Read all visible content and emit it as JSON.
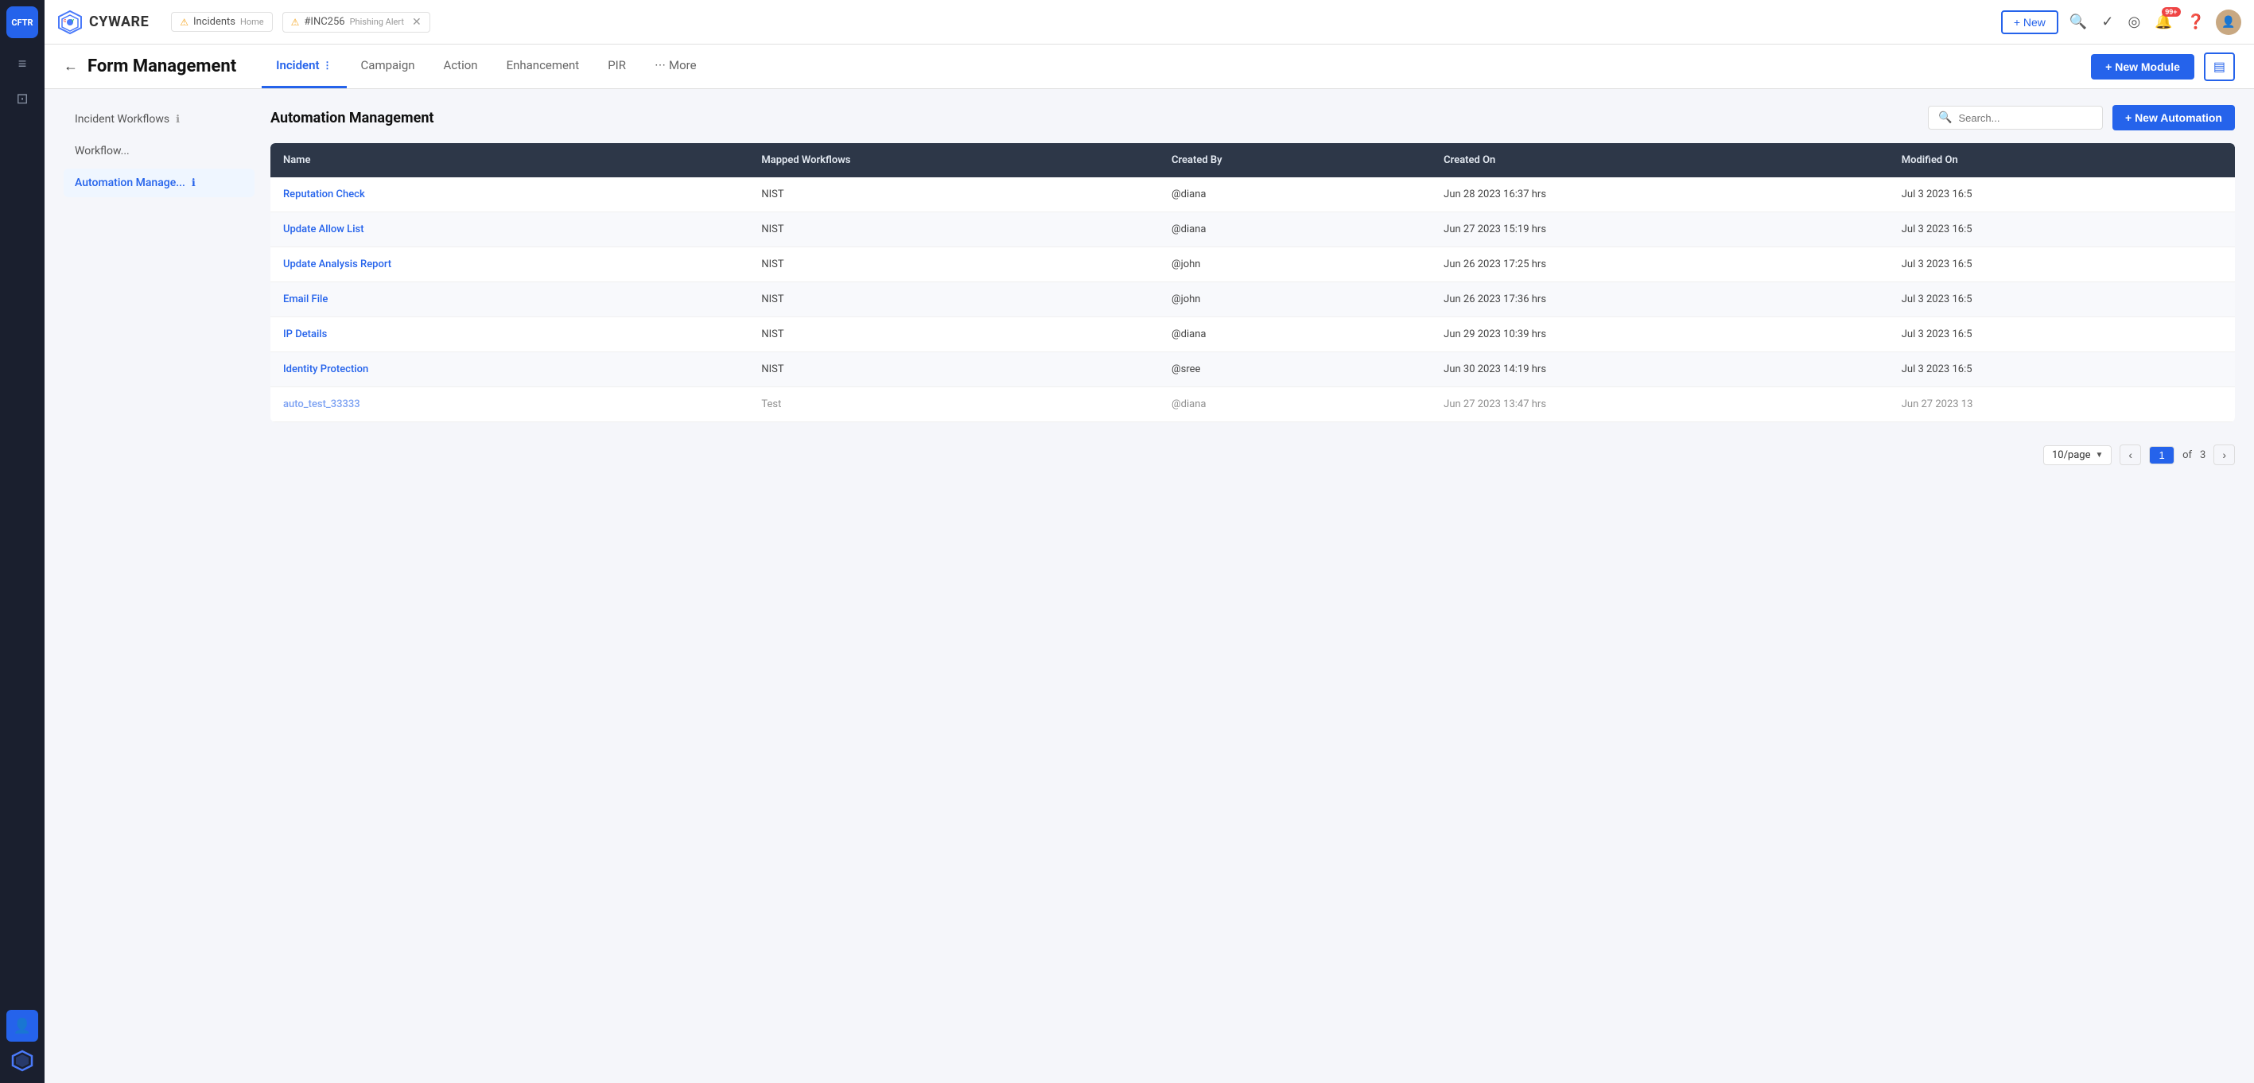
{
  "sidebar": {
    "brand_label": "CFTR",
    "items": [
      {
        "id": "menu",
        "icon": "≡",
        "label": "Menu",
        "active": false
      },
      {
        "id": "terminal",
        "icon": "⊡",
        "label": "Terminal",
        "active": false
      },
      {
        "id": "user",
        "icon": "👤",
        "label": "User",
        "active": true
      },
      {
        "id": "cyware",
        "icon": "✦",
        "label": "Cyware",
        "active": false
      }
    ]
  },
  "topbar": {
    "logo_alt": "Cyware",
    "new_btn_label": "+ New",
    "tabs": [
      {
        "id": "incidents-home",
        "label": "Incidents",
        "sub": "Home",
        "warn": true,
        "closable": false
      },
      {
        "id": "inc256",
        "label": "#INC256",
        "sub": "Phishing Alert",
        "warn": true,
        "closable": true
      }
    ],
    "notif_count": "99+",
    "search_placeholder": "Search"
  },
  "page_header": {
    "back_label": "←",
    "title": "Form Management",
    "tabs": [
      {
        "id": "incident",
        "label": "Incident",
        "has_menu": true,
        "active": true
      },
      {
        "id": "campaign",
        "label": "Campaign",
        "active": false
      },
      {
        "id": "action",
        "label": "Action",
        "active": false
      },
      {
        "id": "enhancement",
        "label": "Enhancement",
        "active": false
      },
      {
        "id": "pir",
        "label": "PIR",
        "active": false
      },
      {
        "id": "more",
        "label": "More",
        "has_more": true,
        "active": false
      }
    ],
    "new_module_btn": "+ New Module",
    "grid_btn_icon": "▤"
  },
  "left_panel": {
    "items": [
      {
        "id": "incident-workflows",
        "label": "Incident Workflows",
        "has_info": true,
        "active": false
      },
      {
        "id": "workflow",
        "label": "Workflow...",
        "has_info": false,
        "active": false
      },
      {
        "id": "automation-manage",
        "label": "Automation Manage...",
        "has_info": true,
        "active": true
      }
    ]
  },
  "automation": {
    "title": "Automation Management",
    "search_placeholder": "Search...",
    "new_btn": "+ New Automation",
    "table": {
      "columns": [
        "Name",
        "Mapped Workflows",
        "Created By",
        "Created On",
        "Modified On"
      ],
      "rows": [
        {
          "name": "Reputation Check",
          "workflows": "NIST",
          "created_by": "@diana",
          "created_on": "Jun 28 2023 16:37 hrs",
          "modified_on": "Jul 3 2023 16:5"
        },
        {
          "name": "Update Allow List",
          "workflows": "NIST",
          "created_by": "@diana",
          "created_on": "Jun 27 2023 15:19 hrs",
          "modified_on": "Jul 3 2023 16:5"
        },
        {
          "name": "Update Analysis Report",
          "workflows": "NIST",
          "created_by": "@john",
          "created_on": "Jun 26 2023 17:25 hrs",
          "modified_on": "Jul 3 2023 16:5"
        },
        {
          "name": "Email File",
          "workflows": "NIST",
          "created_by": "@john",
          "created_on": "Jun 26 2023 17:36 hrs",
          "modified_on": "Jul 3 2023 16:5"
        },
        {
          "name": "IP Details",
          "workflows": "NIST",
          "created_by": "@diana",
          "created_on": "Jun 29 2023 10:39 hrs",
          "modified_on": "Jul 3 2023 16:5"
        },
        {
          "name": "Identity Protection",
          "workflows": "NIST",
          "created_by": "@sree",
          "created_on": "Jun 30 2023 14:19 hrs",
          "modified_on": "Jul 3 2023 16:5"
        },
        {
          "name": "auto_test_33333",
          "workflows": "Test",
          "created_by": "@diana",
          "created_on": "Jun 27 2023 13:47 hrs",
          "modified_on": "Jun 27 2023 13",
          "partial": true
        }
      ]
    },
    "pagination": {
      "per_page": "10/page",
      "current_page": "1",
      "total_pages": "3",
      "of_label": "of",
      "prev_icon": "‹",
      "next_icon": "›"
    }
  }
}
